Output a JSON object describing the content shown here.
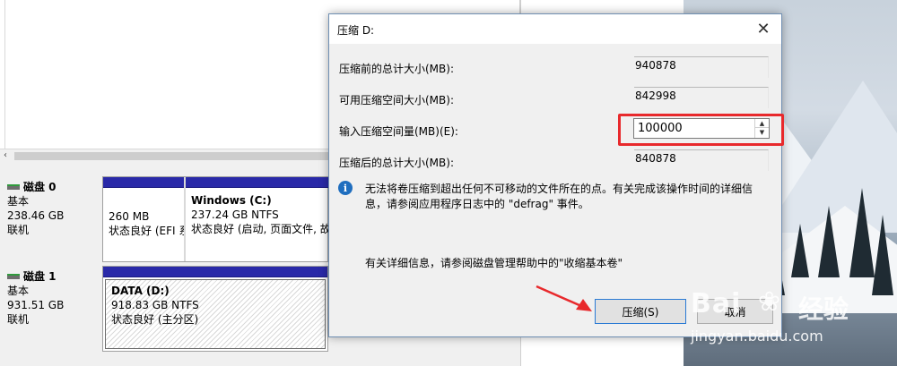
{
  "disks": [
    {
      "name": "磁盘 0",
      "type": "基本",
      "size": "238.46 GB",
      "status": "联机",
      "partitions": [
        {
          "size": "260 MB",
          "status": "状态良好 (EFI 系"
        },
        {
          "title": "Windows  (C:)",
          "size": "237.24 GB NTFS",
          "status": "状态良好 (启动, 页面文件, 故障"
        }
      ]
    },
    {
      "name": "磁盘 1",
      "type": "基本",
      "size": "931.51 GB",
      "status": "联机",
      "partitions": [
        {
          "title": "DATA  (D:)",
          "size": "918.83 GB NTFS",
          "status": "状态良好 (主分区)"
        }
      ]
    }
  ],
  "dialog": {
    "title": "压缩 D:",
    "close_glyph": "✕",
    "labels": {
      "total_before": "压缩前的总计大小(MB):",
      "available": "可用压缩空间大小(MB):",
      "enter_amount": "输入压缩空间量(MB)(E):",
      "total_after": "压缩后的总计大小(MB):"
    },
    "values": {
      "total_before": "940878",
      "available": "842998",
      "enter_amount": "100000",
      "total_after": "840878"
    },
    "info_text": "无法将卷压缩到超出任何不可移动的文件所在的点。有关完成该操作时间的详细信息，请参阅应用程序日志中的 \"defrag\" 事件。",
    "help_text": "有关详细信息，请参阅磁盘管理帮助中的\"收缩基本卷\"",
    "buttons": {
      "shrink": "压缩(S)",
      "cancel": "取消"
    }
  },
  "watermark": {
    "logo": "Bai",
    "brand_cn": "经验",
    "url": "jingyan.baidu.com"
  },
  "colors": {
    "partition_bar": "#2929a8",
    "highlight": "#e8292c",
    "info_icon": "#1f6ebf",
    "focus_border": "#2a7ad4"
  }
}
